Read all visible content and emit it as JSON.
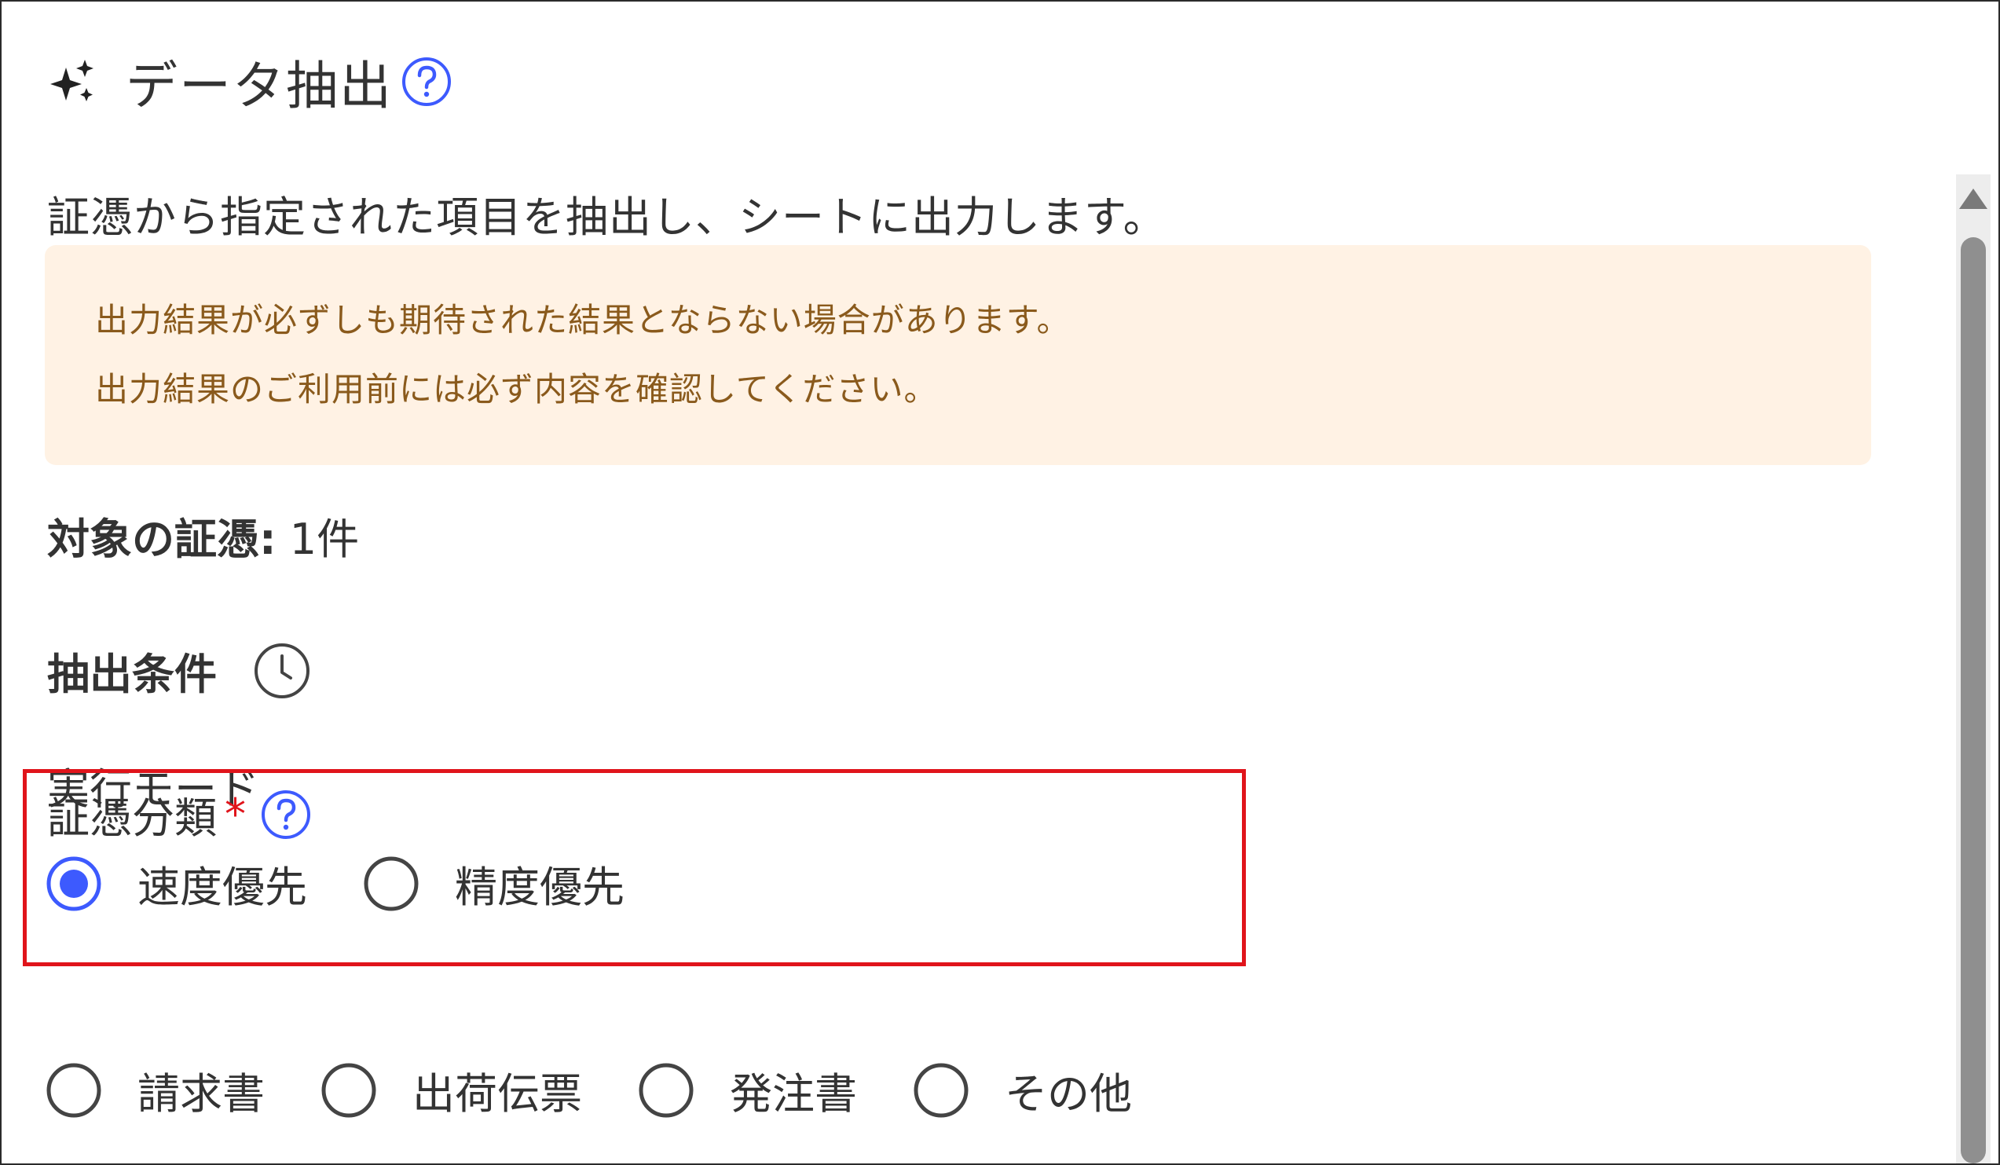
{
  "header": {
    "title": "データ抽出",
    "icon": "sparkle-icon",
    "help_icon": "question-circle-icon"
  },
  "description": "証憑から指定された項目を抽出し、シートに出力します。",
  "notice": {
    "line1": "出力結果が必ずしも期待された結果とならない場合があります。",
    "line2": "出力結果のご利用前には必ず内容を確認してください。"
  },
  "target": {
    "label": "対象の証憑:",
    "value": "1件"
  },
  "conditions": {
    "label": "抽出条件",
    "icon": "history-clock-icon"
  },
  "mode": {
    "label": "実行モード",
    "options": [
      {
        "label": "速度優先",
        "selected": true
      },
      {
        "label": "精度優先",
        "selected": false
      }
    ]
  },
  "classification": {
    "label": "証憑分類",
    "required_mark": "*",
    "options": [
      {
        "label": "請求書",
        "selected": false
      },
      {
        "label": "出荷伝票",
        "selected": false
      },
      {
        "label": "発注書",
        "selected": false
      },
      {
        "label": "その他",
        "selected": false
      }
    ]
  },
  "colors": {
    "accent": "#3d5afe",
    "required": "#e0141b",
    "highlight_box": "#e0141b",
    "notice_bg": "#fff2e4",
    "notice_text": "#8a5a1c"
  }
}
